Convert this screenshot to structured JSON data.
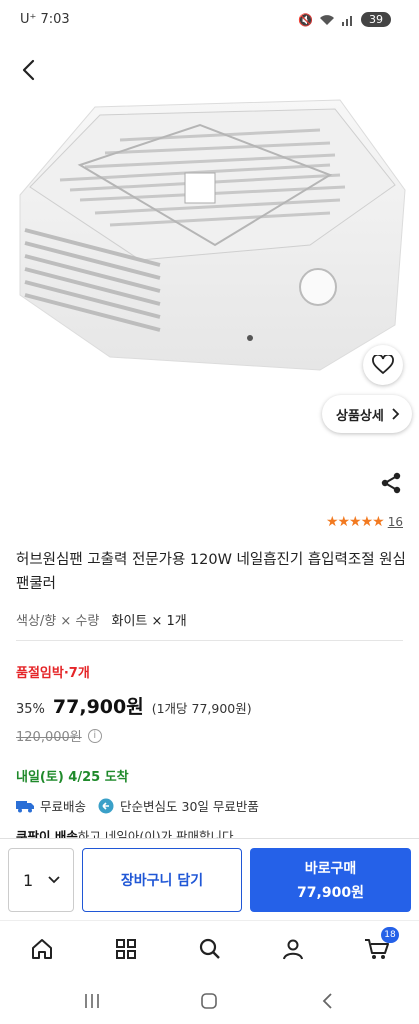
{
  "status_bar": {
    "time": "U⁺ 7:03",
    "battery": "39"
  },
  "product": {
    "detail_label": "상품상세",
    "rating_stars": "★★★★★",
    "review_count": "16",
    "title": "허브원심팬 고출력 전문가용 120W 네일흡진기 흡입력조절 원심팬쿨러",
    "option_label": "색상/향 × 수량",
    "option_value": "화이트 × 1개",
    "urgent_text": "품절임박·7개",
    "discount": "35%",
    "price": "77,900원",
    "unit_price": "(1개당 77,900원)",
    "original_price": "120,000원",
    "delivery": "내일(토) 4/25 도착",
    "free_shipping": "무료배송",
    "free_return": "단순변심도 30일 무료반품",
    "seller_brand": "쿠팡이 배송",
    "seller_text": "하고 네일아(이)가 판매합니다"
  },
  "buybar": {
    "quantity": "1",
    "cart_label": "장바구니 담기",
    "buy_label": "바로구매",
    "buy_price": "77,900원"
  },
  "navbar": {
    "cart_count": "18"
  },
  "colors": {
    "accent": "#2561e8",
    "urgent": "#e52528",
    "delivery": "#1f8a2b",
    "star": "#f27a21"
  }
}
